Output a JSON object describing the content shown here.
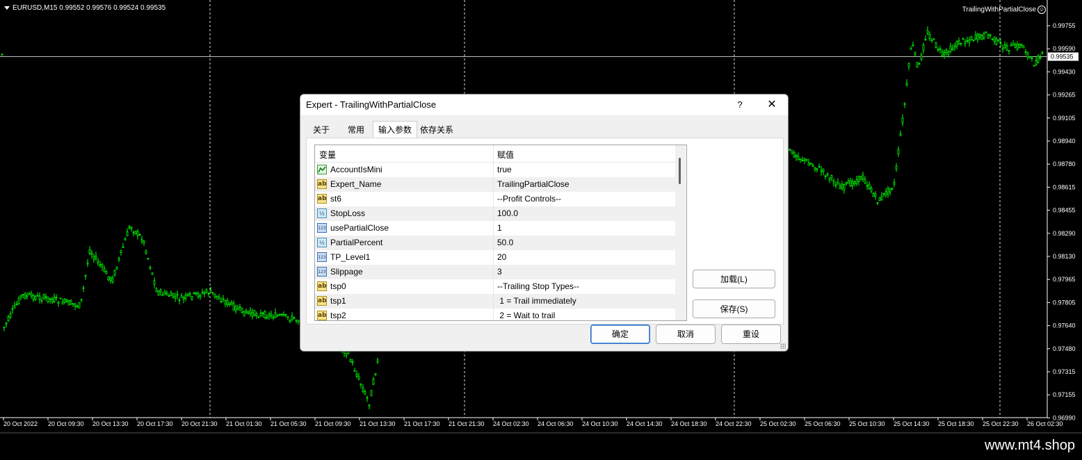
{
  "chart": {
    "header": "EURUSD,M15  0.99552 0.99576 0.99524 0.99535",
    "ea_label": "TrailingWithPartialClose",
    "current_price": "0.99535",
    "price_levels": [
      "0.99755",
      "0.99590",
      "0.99430",
      "0.99265",
      "0.99105",
      "0.98940",
      "0.98780",
      "0.98615",
      "0.98455",
      "0.98290",
      "0.98130",
      "0.97965",
      "0.97805",
      "0.97640",
      "0.97480",
      "0.97315",
      "0.97155",
      "0.96990"
    ],
    "time_labels": [
      "20 Oct 2022",
      "20 Oct 09:30",
      "20 Oct 13:30",
      "20 Oct 17:30",
      "20 Oct 21:30",
      "21 Oct 01:30",
      "21 Oct 05:30",
      "21 Oct 09:30",
      "21 Oct 13:30",
      "21 Oct 17:30",
      "21 Oct 21:30",
      "24 Oct 02:30",
      "24 Oct 06:30",
      "24 Oct 10:30",
      "24 Oct 14:30",
      "24 Oct 18:30",
      "24 Oct 22:30",
      "25 Oct 02:30",
      "25 Oct 06:30",
      "25 Oct 10:30",
      "25 Oct 14:30",
      "25 Oct 18:30",
      "25 Oct 22:30",
      "26 Oct 02:30"
    ],
    "candle_color": "#00ff00",
    "background": "#000000"
  },
  "dialog": {
    "title": "Expert - TrailingWithPartialClose",
    "help_label": "?",
    "close_label": "✕",
    "tabs": [
      {
        "label": "关于",
        "active": false
      },
      {
        "label": "常用",
        "active": false
      },
      {
        "label": "输入参数",
        "active": true
      },
      {
        "label": "依存关系",
        "active": false
      }
    ],
    "grid": {
      "col_variable": "变量",
      "col_value": "赋值",
      "rows": [
        {
          "type": "bool",
          "name": "AccountIsMini",
          "value": "true"
        },
        {
          "type": "string",
          "name": "Expert_Name",
          "value": "TrailingPartialClose"
        },
        {
          "type": "string",
          "name": "st6",
          "value": "--Profit Controls--"
        },
        {
          "type": "double",
          "name": "StopLoss",
          "value": "100.0"
        },
        {
          "type": "int",
          "name": "usePartialClose",
          "value": "1"
        },
        {
          "type": "double",
          "name": "PartialPercent",
          "value": "50.0"
        },
        {
          "type": "int",
          "name": "TP_Level1",
          "value": "20"
        },
        {
          "type": "int",
          "name": "Slippage",
          "value": "3"
        },
        {
          "type": "string",
          "name": "tsp0",
          "value": "--Trailing Stop Types--"
        },
        {
          "type": "string",
          "name": "tsp1",
          "value": " 1 = Trail immediately"
        },
        {
          "type": "string",
          "name": "tsp2",
          "value": " 2 = Wait to trail"
        }
      ]
    },
    "load_label": "加载(L)",
    "save_label": "保存(S)",
    "ok_label": "确定",
    "cancel_label": "取消",
    "reset_label": "重设"
  },
  "watermark": "www.mt4.shop"
}
